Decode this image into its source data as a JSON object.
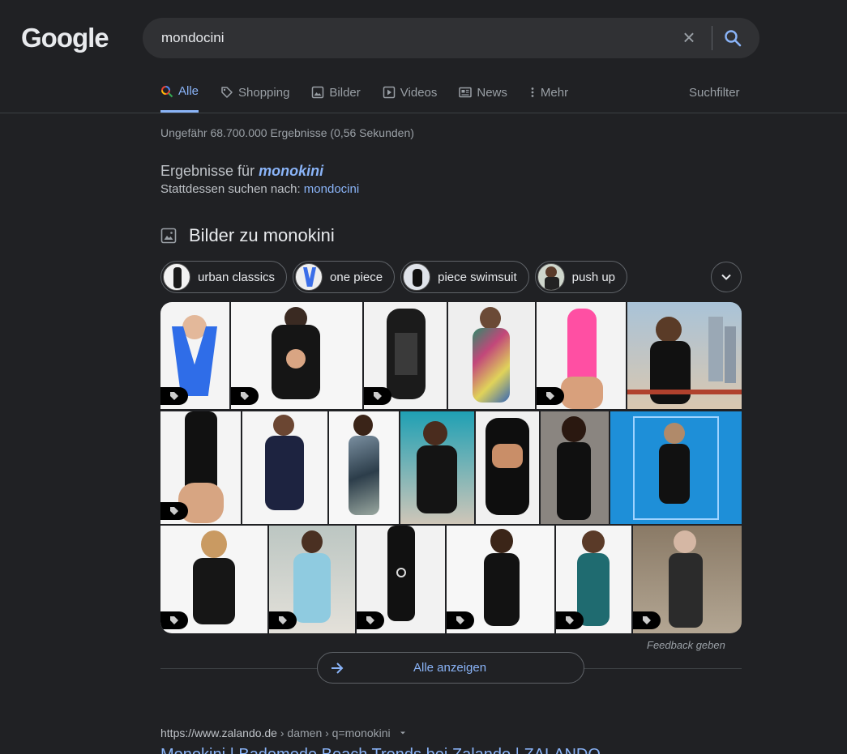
{
  "logo": "Google",
  "search": {
    "query": "mondocini"
  },
  "tabs": [
    {
      "label": "Alle",
      "icon": "search-icon"
    },
    {
      "label": "Shopping",
      "icon": "tag-icon"
    },
    {
      "label": "Bilder",
      "icon": "image-icon"
    },
    {
      "label": "Videos",
      "icon": "play-icon"
    },
    {
      "label": "News",
      "icon": "news-icon"
    },
    {
      "label": "Mehr",
      "icon": "more-vert-icon"
    }
  ],
  "suchfilter": "Suchfilter",
  "stats": "Ungefähr 68.700.000 Ergebnisse (0,56 Sekunden)",
  "correction": {
    "prefix": "Ergebnisse für",
    "corrected": "monokini",
    "instead_prefix": "Stattdessen suchen nach:",
    "original": "mondocini"
  },
  "images_section": {
    "title": "Bilder zu monokini",
    "chips": [
      "urban classics",
      "one piece",
      "piece swimsuit",
      "push up"
    ],
    "feedback": "Feedback geben",
    "show_all": "Alle anzeigen"
  },
  "result": {
    "url": "https://www.zalando.de",
    "breadcrumb": " › damen › q=monokini",
    "title": "Monokini | Bademode Beach Trends bei Zalando | ZALANDO"
  },
  "colors": {
    "accent": "#8ab4f8",
    "background": "#202124"
  }
}
